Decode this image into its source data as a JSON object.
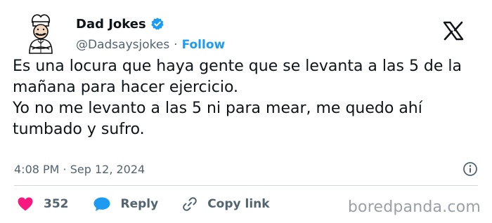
{
  "author": {
    "display_name": "Dad Jokes",
    "handle": "@Dadsaysjokes",
    "separator": "·",
    "follow_label": "Follow"
  },
  "tweet": {
    "line1": "Es una locura que haya gente que se levanta a las 5 de la mañana para hacer ejercicio.",
    "line2": "Yo no me levanto a las 5 ni para mear, me quedo ahí tumbado y sufro."
  },
  "meta": {
    "timestamp": "4:08 PM · Sep 12, 2024"
  },
  "actions": {
    "likes_count": "352",
    "reply_label": "Reply",
    "copy_link_label": "Copy link"
  },
  "watermark": "boredpanda.com",
  "colors": {
    "accent": "#1d9bf0",
    "like": "#f91880",
    "text": "#0f1419",
    "muted": "#536471"
  },
  "icons": [
    "avatar-chef-illustration",
    "verified-badge-icon",
    "x-logo-icon",
    "info-icon",
    "heart-icon",
    "reply-bubble-icon",
    "link-icon"
  ]
}
